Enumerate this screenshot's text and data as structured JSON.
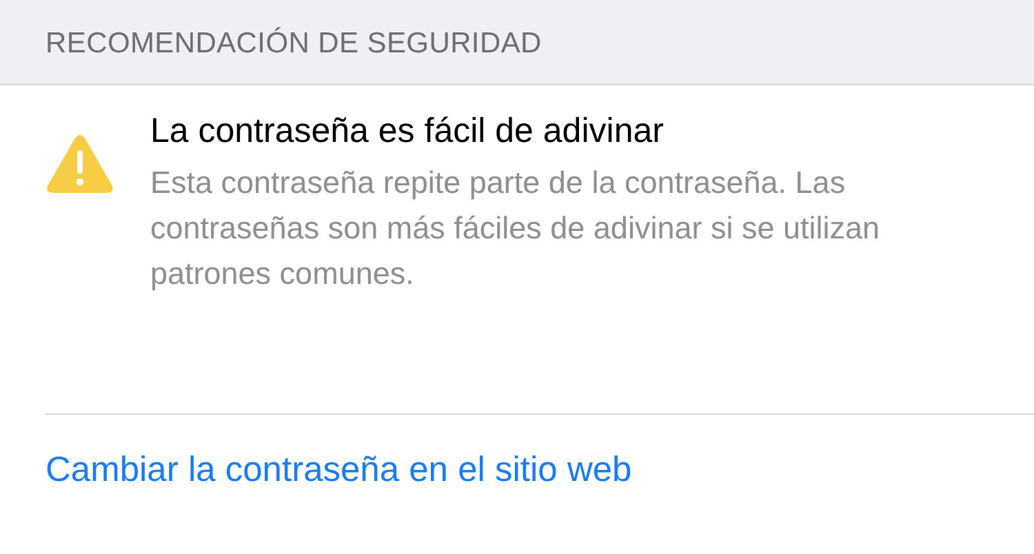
{
  "section_header": "RECOMENDACIÓN DE SEGURIDAD",
  "recommendation": {
    "title": "La contraseña es fácil de adivinar",
    "description": "Esta contraseña repite parte de la contraseña. Las contraseñas son más fáciles de adivinar si se utilizan patrones comunes."
  },
  "action_link": "Cambiar la contraseña en el sitio web"
}
